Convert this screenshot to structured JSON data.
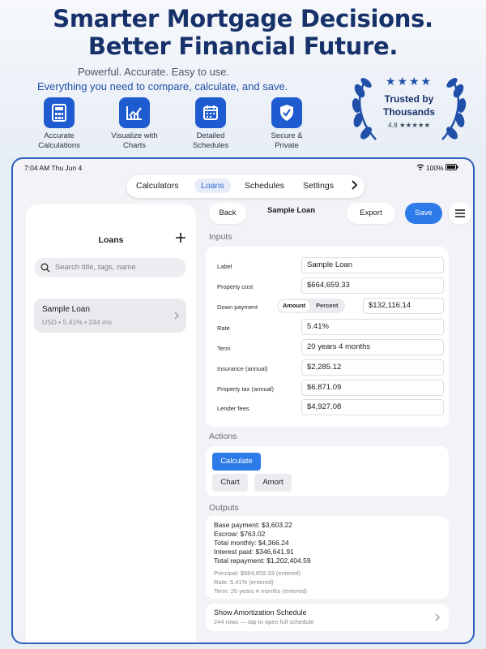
{
  "promo": {
    "headline_line1": "Smarter Mortgage Decisions.",
    "headline_line2": "Better Financial Future.",
    "subtitle": "Powerful. Accurate. Easy to use.",
    "tagline": "Everything you need to compare, calculate, and save.",
    "features": [
      {
        "label_line1": "Accurate",
        "label_line2": "Calculations",
        "icon": "calculator-icon"
      },
      {
        "label_line1": "Visualize with",
        "label_line2": "Charts",
        "icon": "chart-icon"
      },
      {
        "label_line1": "Detailed",
        "label_line2": "Schedules",
        "icon": "calendar-icon"
      },
      {
        "label_line1": "Secure &",
        "label_line2": "Private",
        "icon": "shield-check-icon"
      }
    ],
    "badge": {
      "stars": "★★★★",
      "line1": "Trusted by",
      "line2": "Thousands",
      "rating": "4.8 ★★★★★"
    },
    "accent_color": "#1f5bd0",
    "headline_color": "#17316a"
  },
  "status_bar": {
    "time_date": "7:04 AM  Thu Jun 4",
    "battery": "100%"
  },
  "tabs": {
    "items": [
      "Calculators",
      "Loans",
      "Schedules",
      "Settings"
    ],
    "active": "Loans"
  },
  "sidebar": {
    "title": "Loans",
    "search_placeholder": "Search title, tags, name",
    "loans": [
      {
        "title": "Sample Loan",
        "meta": "USD • 5.41% • 244 mo"
      }
    ]
  },
  "toolbar": {
    "back_label": "Back",
    "title": "Sample Loan",
    "export_label": "Export",
    "save_label": "Save"
  },
  "inputs": {
    "heading": "Inputs",
    "label_label": "Label",
    "label_value": "Sample Loan",
    "property_cost_label": "Property cost",
    "property_cost_value": "$664,659.33",
    "down_payment_label": "Down payment",
    "down_payment_mode_amount": "Amount",
    "down_payment_mode_percent": "Percent",
    "down_payment_value": "$132,116.14",
    "rate_label": "Rate",
    "rate_value": "5.41%",
    "term_label": "Term",
    "term_value": "20 years 4 months",
    "insurance_label": "Insurance (annual)",
    "insurance_value": "$2,285.12",
    "property_tax_label": "Property tax (annual)",
    "property_tax_value": "$6,871.09",
    "lender_fees_label": "Lender fees",
    "lender_fees_value": "$4,927.08"
  },
  "actions": {
    "heading": "Actions",
    "calculate_label": "Calculate",
    "chart_label": "Chart",
    "amort_label": "Amort"
  },
  "outputs": {
    "heading": "Outputs",
    "base_payment": "Base payment: $3,603.22",
    "escrow": "Escrow: $763.02",
    "total_monthly": "Total monthly: $4,366.24",
    "interest_paid": "Interest paid: $346,641.91",
    "total_repayment": "Total repayment: $1,202,404.59",
    "note_principal": "Principal: $664,659.33 (entered)",
    "note_rate": "Rate: 5.41% (entered)",
    "note_term": "Term: 20 years 4 months (entered)"
  },
  "amortization": {
    "title": "Show Amortization Schedule",
    "subtitle": "244 rows — tap to open full schedule"
  }
}
